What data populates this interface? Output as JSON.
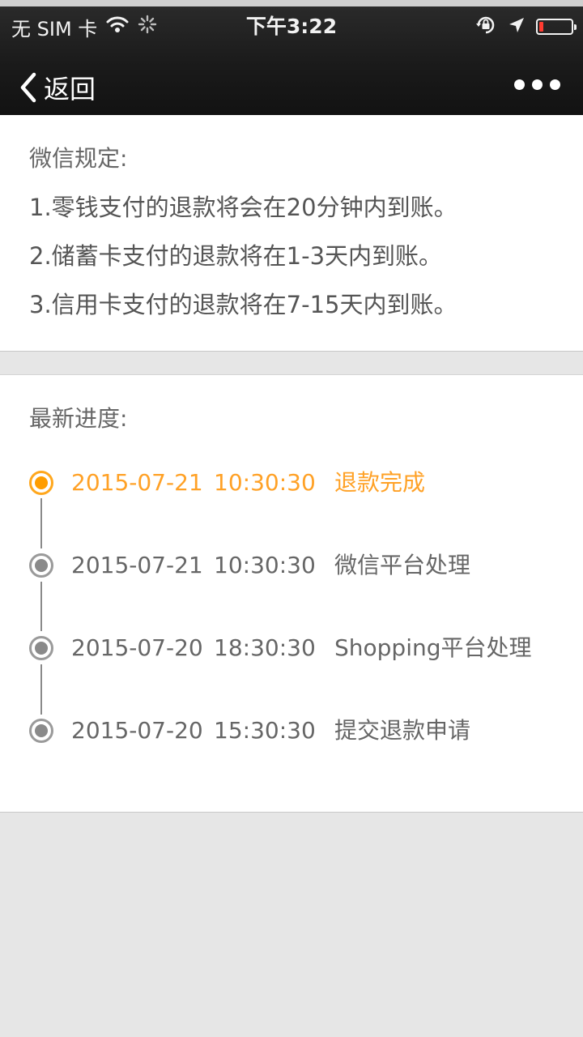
{
  "status_bar": {
    "carrier": "无 SIM 卡",
    "time": "下午3:22",
    "battery_level": 0.12
  },
  "nav": {
    "back_label": "返回"
  },
  "rules": {
    "title": "微信规定:",
    "lines": [
      "1.零钱支付的退款将会在20分钟内到账。",
      "2.储蓄卡支付的退款将在1-3天内到账。",
      "3.信用卡支付的退款将在7-15天内到账。"
    ]
  },
  "progress": {
    "title": "最新进度:",
    "steps": [
      {
        "date": "2015-07-21",
        "time": "10:30:30",
        "status": "退款完成",
        "active": true
      },
      {
        "date": "2015-07-21",
        "time": "10:30:30",
        "status": "微信平台处理",
        "active": false
      },
      {
        "date": "2015-07-20",
        "time": "18:30:30",
        "status": "Shopping平台处理",
        "active": false
      },
      {
        "date": "2015-07-20",
        "time": "15:30:30",
        "status": "提交退款申请",
        "active": false
      }
    ]
  },
  "colors": {
    "accent": "#ff9d00",
    "text": "#666666",
    "battery_low": "#ff3b30"
  }
}
